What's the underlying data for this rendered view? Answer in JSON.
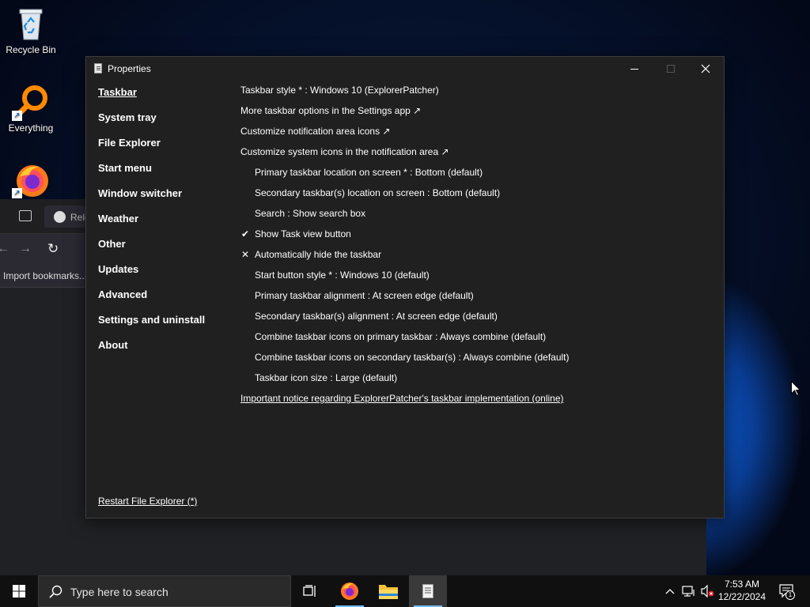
{
  "desktop": {
    "icons": [
      {
        "label": "Recycle Bin"
      },
      {
        "label": "Everything"
      },
      {
        "label": ""
      }
    ]
  },
  "background_browser": {
    "tab_label": "Rele",
    "bookmark_label": "Import bookmarks..."
  },
  "window": {
    "title": "Properties",
    "sidebar": {
      "items": [
        {
          "label": "Taskbar"
        },
        {
          "label": "System tray"
        },
        {
          "label": "File Explorer"
        },
        {
          "label": "Start menu"
        },
        {
          "label": "Window switcher"
        },
        {
          "label": "Weather"
        },
        {
          "label": "Other"
        },
        {
          "label": "Updates"
        },
        {
          "label": "Advanced"
        },
        {
          "label": "Settings and uninstall"
        },
        {
          "label": "About"
        }
      ],
      "active_index": 0,
      "restart_link": "Restart File Explorer (*)"
    },
    "options": [
      {
        "label": "Taskbar style * : Windows 10 (ExplorerPatcher)"
      },
      {
        "label": "More taskbar options in the Settings app ↗"
      },
      {
        "label": "Customize notification area icons ↗"
      },
      {
        "label": "Customize system icons in the notification area ↗"
      },
      {
        "label": "Primary taskbar location on screen * : Bottom (default)"
      },
      {
        "label": "Secondary taskbar(s) location on screen : Bottom (default)"
      },
      {
        "label": "Search : Show search box"
      },
      {
        "label": "Show Task view button",
        "mark": "✔"
      },
      {
        "label": "Automatically hide the taskbar",
        "mark": "✕"
      },
      {
        "label": "Start button style * : Windows 10 (default)"
      },
      {
        "label": "Primary taskbar alignment : At screen edge (default)"
      },
      {
        "label": "Secondary taskbar(s) alignment : At screen edge (default)"
      },
      {
        "label": "Combine taskbar icons on primary taskbar : Always combine (default)"
      },
      {
        "label": "Combine taskbar icons on secondary taskbar(s) : Always combine (default)"
      },
      {
        "label": "Taskbar icon size : Large (default)"
      }
    ],
    "notice_link": "Important notice regarding ExplorerPatcher's taskbar implementation (online)"
  },
  "taskbar": {
    "search_placeholder": "Type here to search",
    "clock_time": "7:53 AM",
    "clock_date": "12/22/2024",
    "notification_count": "1",
    "accent": "#76b9ed"
  }
}
